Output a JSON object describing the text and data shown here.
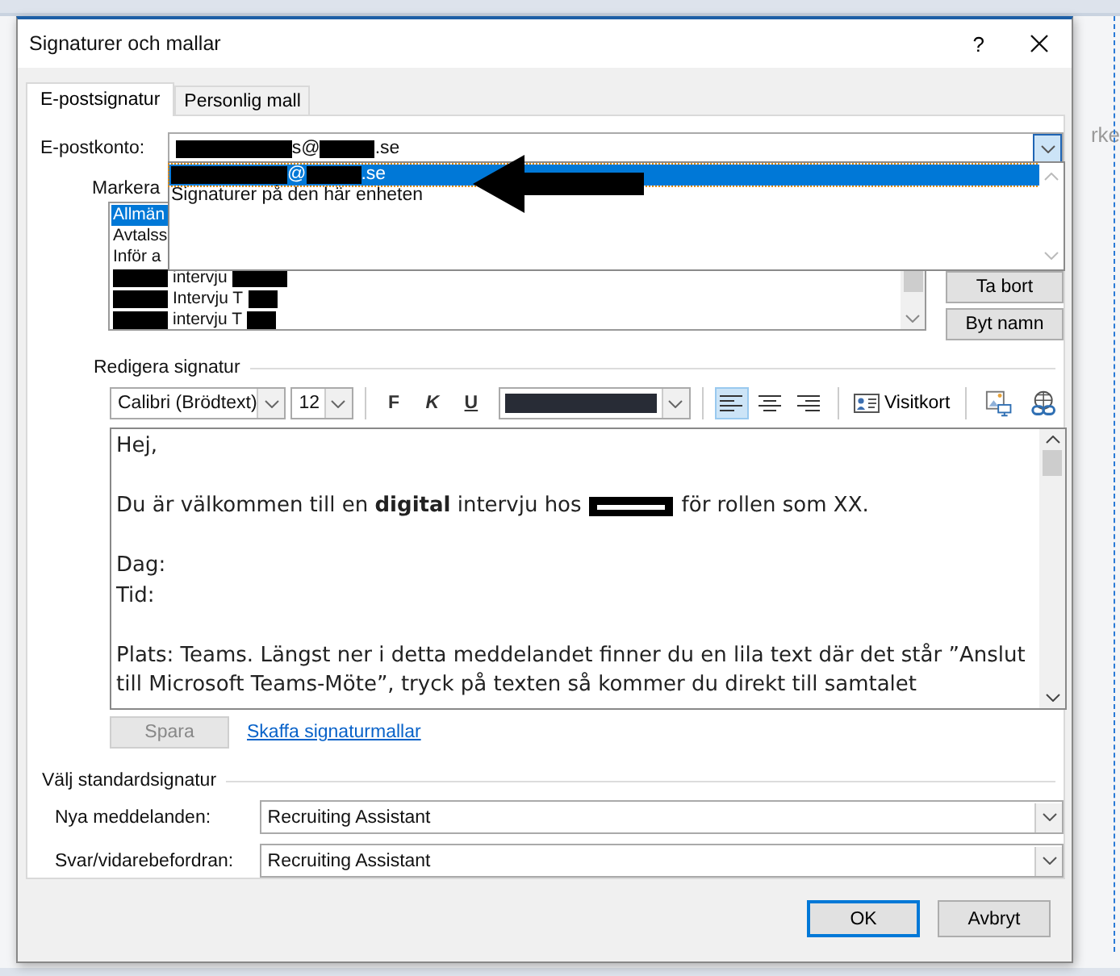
{
  "background_text": "rke",
  "window": {
    "title": "Signaturer och mallar",
    "help": "?"
  },
  "tabs": [
    {
      "label": "E-postsignatur",
      "selected": true
    },
    {
      "label": "Personlig mall",
      "selected": false
    }
  ],
  "account": {
    "label": "E-postkonto:",
    "value": [
      {
        "kind": "redacted-long"
      },
      {
        "kind": "text",
        "text": "s@"
      },
      {
        "kind": "redacted-short"
      },
      {
        "kind": "text",
        "text": ".se"
      }
    ]
  },
  "dropdown": {
    "options": [
      {
        "selected": true,
        "parts": [
          {
            "kind": "redacted-long"
          },
          {
            "kind": "text",
            "text": "@"
          },
          {
            "kind": "redacted-short"
          },
          {
            "kind": "text",
            "text": ".se"
          }
        ]
      },
      {
        "selected": false,
        "parts": [
          {
            "kind": "text",
            "text": "Signaturer på den här enheten"
          }
        ]
      }
    ]
  },
  "select_label": "Markera",
  "signatures": [
    {
      "selected": true,
      "parts": [
        {
          "kind": "text",
          "text": "Allmän"
        }
      ]
    },
    {
      "selected": false,
      "parts": [
        {
          "kind": "text",
          "text": "Avtalss"
        }
      ]
    },
    {
      "selected": false,
      "parts": [
        {
          "kind": "text",
          "text": "Inför a"
        }
      ]
    },
    {
      "selected": false,
      "parts": [
        {
          "kind": "redacted-short"
        },
        {
          "kind": "text",
          "text": "intervju"
        },
        {
          "kind": "redacted-short"
        }
      ]
    },
    {
      "selected": false,
      "parts": [
        {
          "kind": "redacted-short"
        },
        {
          "kind": "text",
          "text": "Intervju T"
        },
        {
          "kind": "redacted-tiny"
        }
      ]
    },
    {
      "selected": false,
      "parts": [
        {
          "kind": "redacted-short"
        },
        {
          "kind": "text",
          "text": "intervju T"
        },
        {
          "kind": "redacted-tiny"
        }
      ]
    }
  ],
  "list_buttons": [
    "Ta bort",
    "Byt namn"
  ],
  "edit": {
    "label": "Redigera signatur",
    "font": "Calibri (Brödtext)",
    "size": "12",
    "format_buttons": [
      "F",
      "K",
      "U"
    ],
    "align": [
      {
        "kind": "left",
        "selected": true
      },
      {
        "kind": "center",
        "selected": false
      },
      {
        "kind": "right",
        "selected": false
      }
    ],
    "business_card": "Visitkort"
  },
  "body": [
    {
      "kind": "line",
      "parts": [
        {
          "kind": "text",
          "text": "Hej,"
        }
      ]
    },
    {
      "kind": "blank"
    },
    {
      "kind": "line",
      "parts": [
        {
          "kind": "text",
          "text": "Du är välkommen till en **digital** intervju hos"
        },
        {
          "kind": "redacted-box"
        },
        {
          "kind": "text",
          "text": "för rollen som XX."
        }
      ]
    },
    {
      "kind": "blank"
    },
    {
      "kind": "line",
      "parts": [
        {
          "kind": "text",
          "text": "Dag:"
        }
      ]
    },
    {
      "kind": "line",
      "parts": [
        {
          "kind": "text",
          "text": "Tid:"
        }
      ]
    },
    {
      "kind": "blank"
    },
    {
      "kind": "line",
      "parts": [
        {
          "kind": "text",
          "text": "Plats: Teams. Längst ner i detta meddelandet finner du en lila text där det står ”Anslut"
        }
      ]
    },
    {
      "kind": "line",
      "parts": [
        {
          "kind": "text",
          "text": "till Microsoft Teams-Möte”, tryck på texten så kommer du direkt till samtalet"
        }
      ]
    }
  ],
  "save": {
    "label": "Spara",
    "disabled": true
  },
  "templates_link": "Skaffa signaturmallar",
  "defaults": {
    "label": "Välj standardsignatur",
    "rows": [
      {
        "label": "Nya meddelanden:",
        "value": "Recruiting Assistant"
      },
      {
        "label": "Svar/vidarebefordran:",
        "value": "Recruiting Assistant"
      }
    ]
  },
  "buttons": [
    "OK",
    "Avbryt"
  ]
}
